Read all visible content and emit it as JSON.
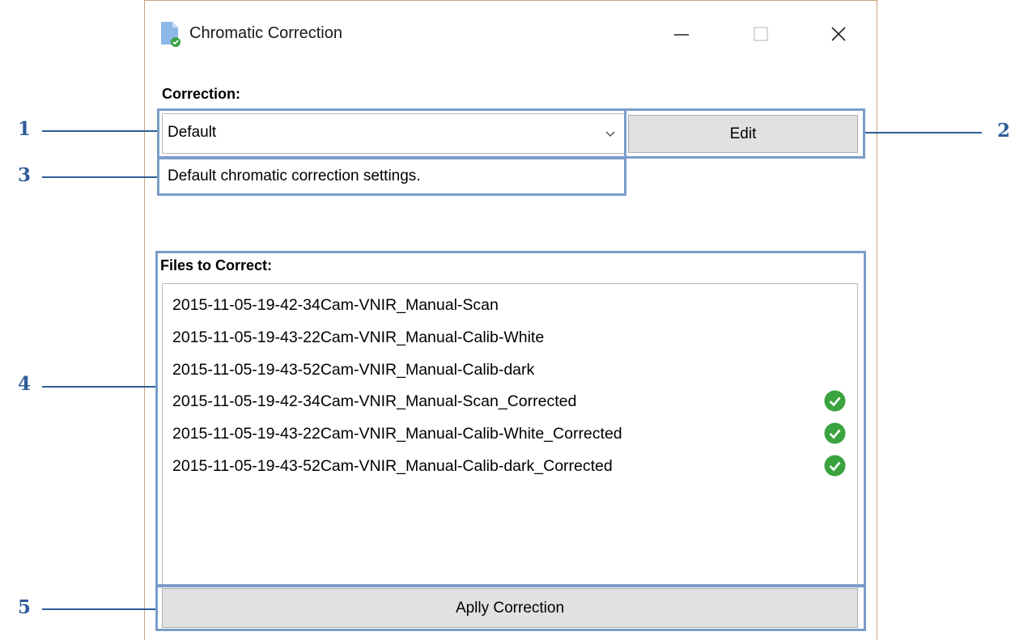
{
  "window": {
    "title": "Chromatic Correction",
    "controls": [
      "minimize-icon",
      "maximize-icon",
      "close-icon"
    ]
  },
  "correction": {
    "label": "Correction:",
    "selected": "Default",
    "edit_label": "Edit",
    "description": "Default chromatic correction settings."
  },
  "files": {
    "label": "Files to Correct:",
    "items": [
      {
        "name": "2015-11-05-19-42-34Cam-VNIR_Manual-Scan",
        "corrected": false
      },
      {
        "name": "2015-11-05-19-43-22Cam-VNIR_Manual-Calib-White",
        "corrected": false
      },
      {
        "name": "2015-11-05-19-43-52Cam-VNIR_Manual-Calib-dark",
        "corrected": false
      },
      {
        "name": "2015-11-05-19-42-34Cam-VNIR_Manual-Scan_Corrected",
        "corrected": true
      },
      {
        "name": "2015-11-05-19-43-22Cam-VNIR_Manual-Calib-White_Corrected",
        "corrected": true
      },
      {
        "name": "2015-11-05-19-43-52Cam-VNIR_Manual-Calib-dark_Corrected",
        "corrected": true
      }
    ]
  },
  "apply_label": "Aplly Correction",
  "callouts": [
    "1",
    "2",
    "3",
    "4",
    "5"
  ],
  "colors": {
    "accent": "#2e5c9a",
    "highlight": "#7a9cc8",
    "check": "#3aa33e"
  }
}
